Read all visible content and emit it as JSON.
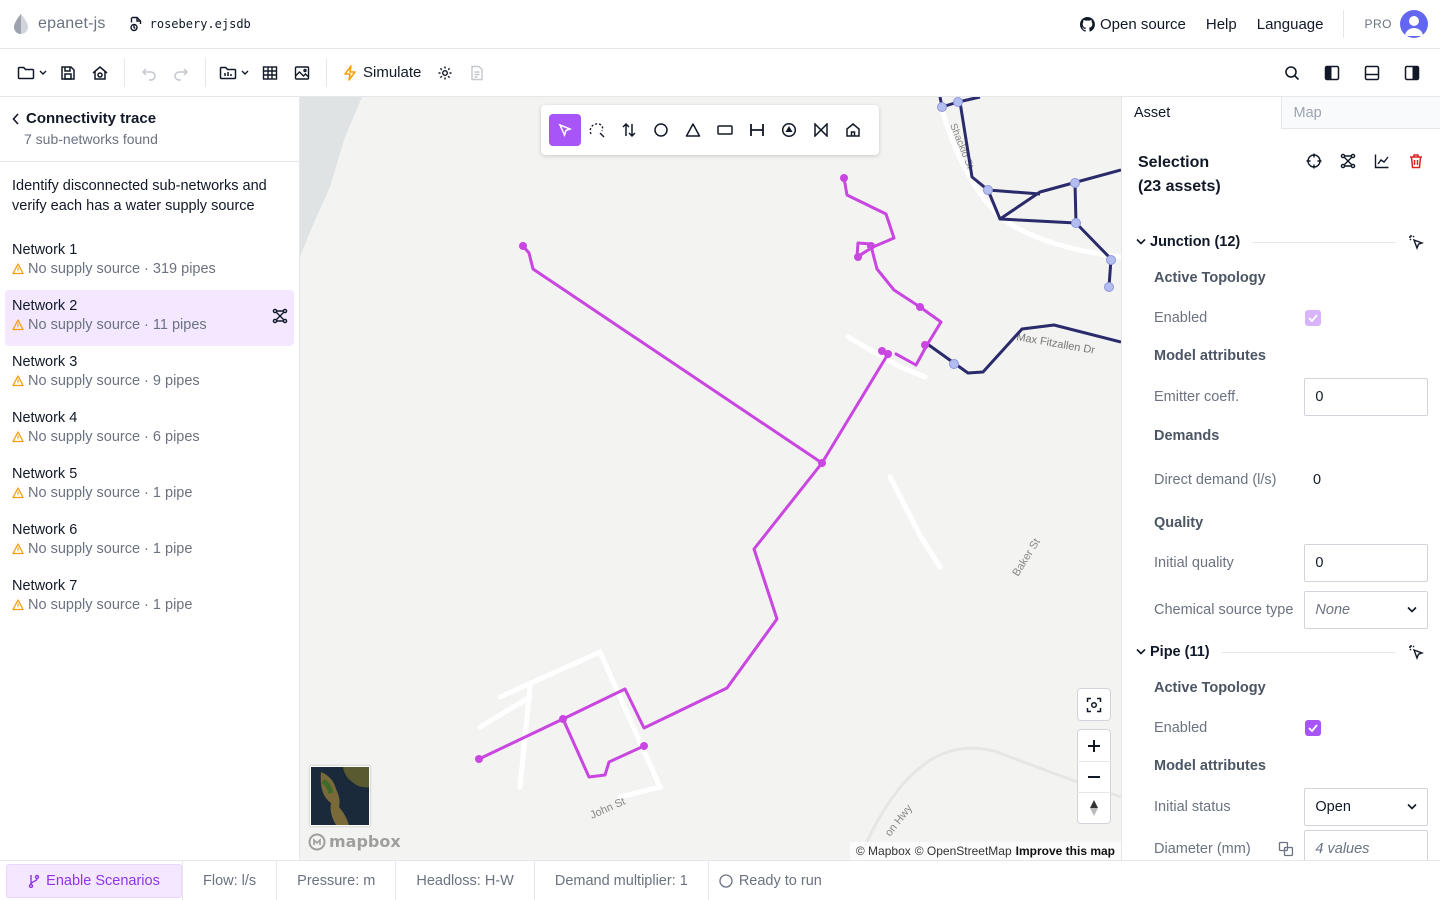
{
  "header": {
    "app_name": "epanet-js",
    "file_name": "rosebery.ejsdb",
    "links": {
      "open_source": "Open source",
      "help": "Help",
      "language": "Language"
    },
    "pro_label": "PRO"
  },
  "toolbar": {
    "simulate_label": "Simulate"
  },
  "left_panel": {
    "title": "Connectivity trace",
    "subtitle": "7 sub-networks found",
    "description": "Identify disconnected sub-networks and verify each has a water supply source",
    "networks": [
      {
        "name": "Network 1",
        "meta": "No supply source · 319 pipes",
        "active": false
      },
      {
        "name": "Network 2",
        "meta": "No supply source · 11 pipes",
        "active": true
      },
      {
        "name": "Network 3",
        "meta": "No supply source · 9 pipes",
        "active": false
      },
      {
        "name": "Network 4",
        "meta": "No supply source · 6 pipes",
        "active": false
      },
      {
        "name": "Network 5",
        "meta": "No supply source · 1 pipe",
        "active": false
      },
      {
        "name": "Network 6",
        "meta": "No supply source · 1 pipe",
        "active": false
      },
      {
        "name": "Network 7",
        "meta": "No supply source · 1 pipe",
        "active": false
      }
    ]
  },
  "map": {
    "street_labels": {
      "max_fitzallen": "Max Fitzallen Dr",
      "baker": "Baker St",
      "john": "John St",
      "hwy": "on Hwy",
      "shacklo": "Shacklo St"
    },
    "mapbox_logo": "mapbox",
    "attribution": {
      "mapbox": "© Mapbox",
      "osm": "© OpenStreetMap",
      "improve": "Improve this map"
    },
    "colors": {
      "selected": "#c946e0",
      "network": "#2b2a6b",
      "node": "#b4bdf0"
    }
  },
  "right_panel": {
    "tabs": {
      "asset": "Asset",
      "map": "Map"
    },
    "selection_title_line1": "Selection",
    "selection_title_line2": "(23 assets)",
    "junction": {
      "group_label": "Junction (12)",
      "active_topology": "Active Topology",
      "enabled_label": "Enabled",
      "model_attributes": "Model attributes",
      "emitter_label": "Emitter coeff.",
      "emitter_value": "0",
      "demands": "Demands",
      "direct_demand_label": "Direct demand (l/s)",
      "direct_demand_value": "0",
      "quality": "Quality",
      "initial_quality_label": "Initial quality",
      "initial_quality_value": "0",
      "chemical_source_label": "Chemical source type",
      "chemical_source_value": "None"
    },
    "pipe": {
      "group_label": "Pipe (11)",
      "active_topology": "Active Topology",
      "enabled_label": "Enabled",
      "model_attributes": "Model attributes",
      "initial_status_label": "Initial status",
      "initial_status_value": "Open",
      "diameter_label": "Diameter (mm)",
      "diameter_value": "4 values"
    }
  },
  "statusbar": {
    "scenarios_label": "Enable Scenarios",
    "flow": "Flow: l/s",
    "pressure": "Pressure: m",
    "headloss": "Headloss: H-W",
    "demand_multiplier": "Demand multiplier: 1",
    "run_status": "Ready to run"
  }
}
